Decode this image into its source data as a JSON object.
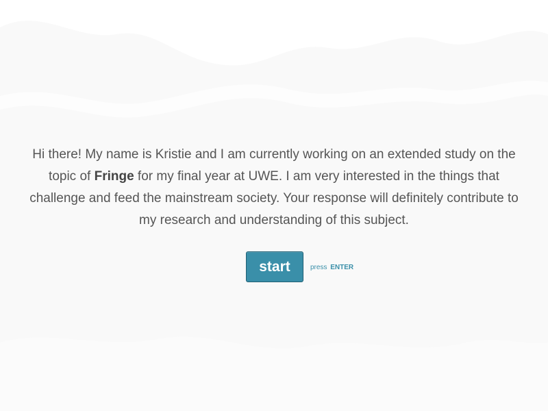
{
  "welcome": {
    "text_before": "Hi there! My name is Kristie and I am currently working on an extended study on the topic of ",
    "emphasis": "Fringe",
    "text_after": " for my final year at UWE. I am very interested in the things that challenge and feed the mainstream society. Your response will definitely contribute to my research and understanding of this subject."
  },
  "start_button": {
    "label": "start"
  },
  "enter_hint": {
    "prefix": "press",
    "key": "ENTER"
  },
  "colors": {
    "accent": "#3a8fa9",
    "text": "#555555",
    "background": "#f9f9f9"
  }
}
